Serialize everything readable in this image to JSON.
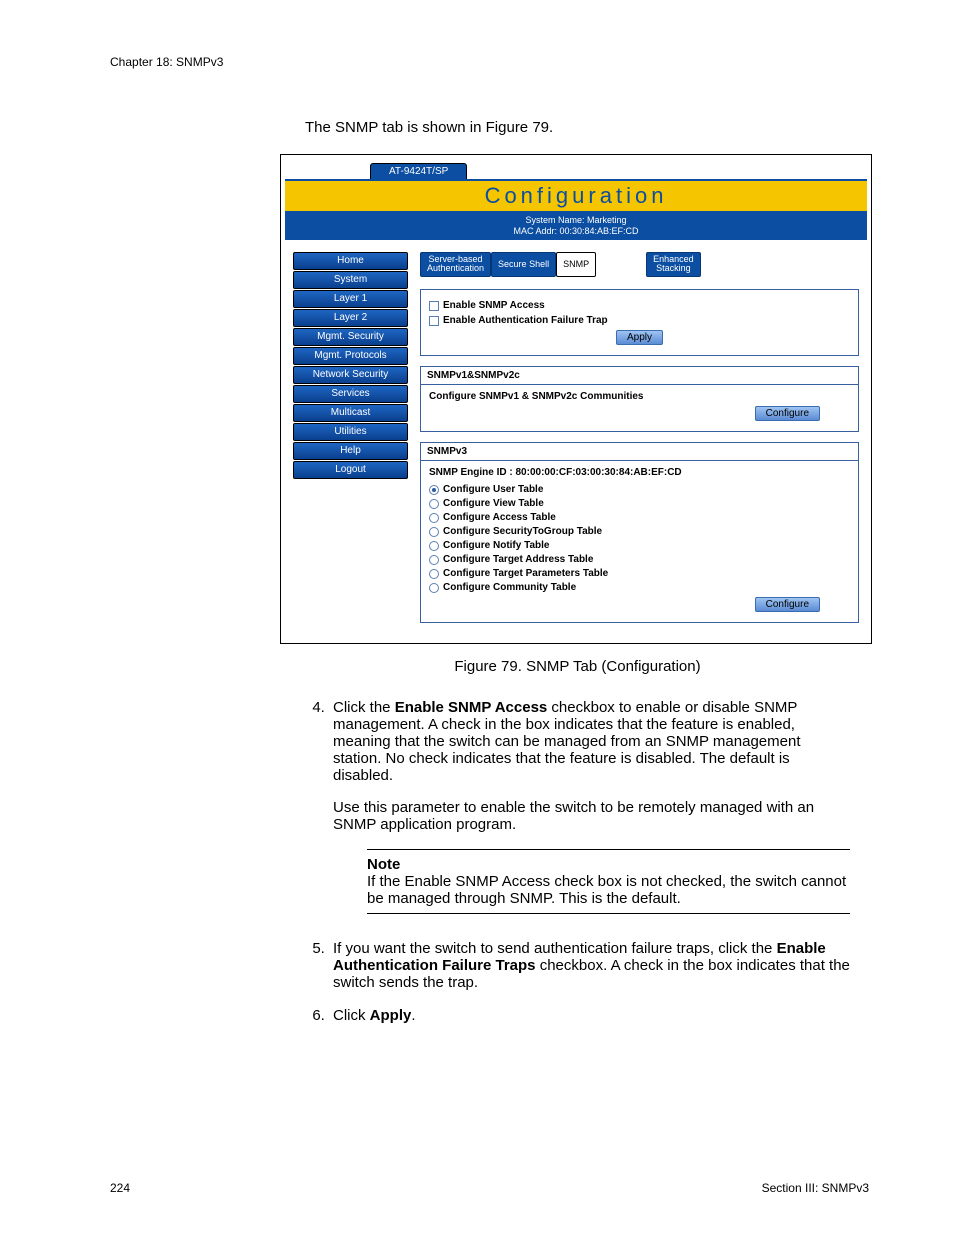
{
  "header": {
    "chapter": "Chapter 18: SNMPv3"
  },
  "intro": "The SNMP tab is shown in Figure 79.",
  "ui": {
    "model": "AT-9424T/SP",
    "title": "Configuration",
    "sys_name_line": "System Name: Marketing",
    "mac_line": "MAC Addr: 00:30:84:AB:EF:CD",
    "nav": [
      "Home",
      "System",
      "Layer 1",
      "Layer 2",
      "Mgmt. Security",
      "Mgmt. Protocols",
      "Network Security",
      "Services",
      "Multicast",
      "Utilities",
      "Help",
      "Logout"
    ],
    "tabs": {
      "t1a": "Server-based",
      "t1b": "Authentication",
      "t2": "Secure Shell",
      "t3": "SNMP",
      "t4a": "Enhanced",
      "t4b": "Stacking"
    },
    "p1": {
      "chk1": "Enable SNMP Access",
      "chk2": "Enable Authentication Failure Trap",
      "apply": "Apply"
    },
    "p2": {
      "hdr": "SNMPv1&SNMPv2c",
      "desc": "Configure SNMPv1 & SNMPv2c Communities",
      "btn": "Configure"
    },
    "p3": {
      "hdr": "SNMPv3",
      "engine_lbl": "SNMP Engine ID :",
      "engine_val": "80:00:00:CF:03:00:30:84:AB:EF:CD",
      "opts": [
        "Configure User Table",
        "Configure View Table",
        "Configure Access Table",
        "Configure SecurityToGroup Table",
        "Configure Notify Table",
        "Configure Target Address Table",
        "Configure Target Parameters Table",
        "Configure Community Table"
      ],
      "btn": "Configure"
    }
  },
  "caption": "Figure 79. SNMP Tab (Configuration)",
  "steps": {
    "s4_a": "Click the ",
    "s4_bold": "Enable SNMP Access",
    "s4_b": " checkbox to enable or disable SNMP management. A check in the box indicates that the feature is enabled, meaning that the switch can be managed from an SNMP management station. No check indicates that the feature is disabled. The default is disabled.",
    "s4_p2": "Use this parameter to enable the switch to be remotely managed with an SNMP application program.",
    "note_head": "Note",
    "note_body": "If the Enable SNMP Access check box is not checked, the switch cannot be managed through SNMP. This is the default.",
    "s5_a": "If you want the switch to send authentication failure traps, click the ",
    "s5_bold": "Enable Authentication Failure Traps",
    "s5_b": " checkbox. A check in the box indicates that the switch sends the trap.",
    "s6_a": "Click ",
    "s6_bold": "Apply",
    "s6_b": "."
  },
  "footer": {
    "page": "224",
    "section": "Section III: SNMPv3"
  }
}
